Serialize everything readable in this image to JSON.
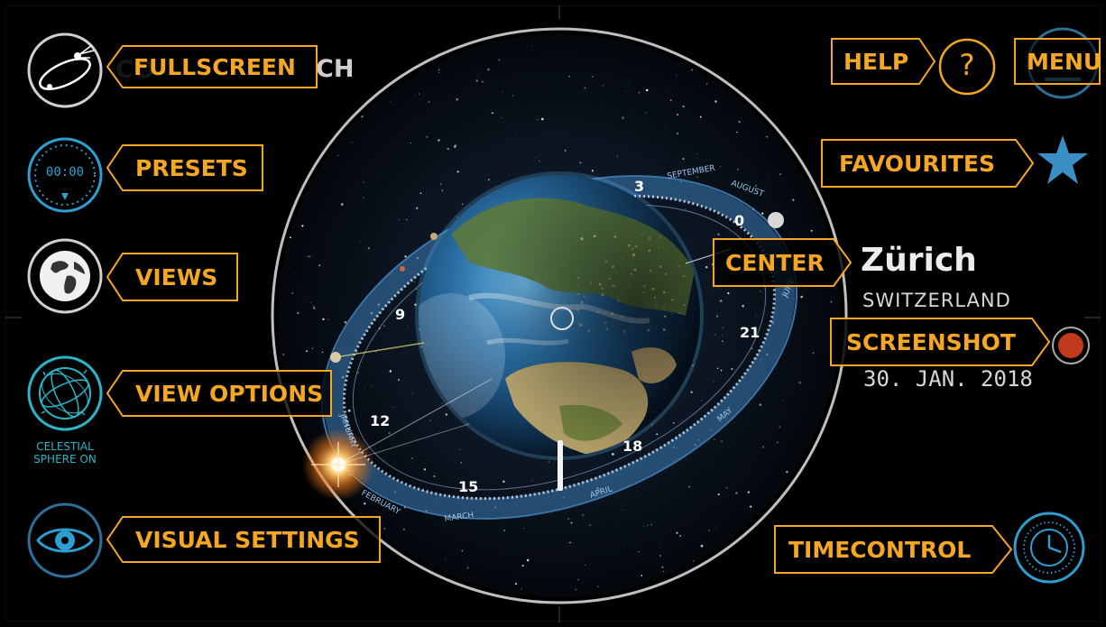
{
  "app": {
    "title_visible": "CH"
  },
  "callouts": {
    "fullscreen": "FULLSCREEN",
    "presets": "PRESETS",
    "views": "VIEWS",
    "view_options": "VIEW OPTIONS",
    "visual_settings": "VISUAL SETTINGS",
    "help": "HELP",
    "menu": "MENU",
    "favourites": "FAVOURITES",
    "center": "CENTER",
    "screenshot": "SCREENSHOT",
    "timecontrol": "TIMECONTROL"
  },
  "presets_icon_time": "00:00",
  "celestial_sphere_status": [
    "CELESTIAL",
    "SPHERE ON"
  ],
  "help_icon_glyph": "?",
  "location": {
    "city": "Zürich",
    "country": "SWITZERLAND",
    "date": "30. JAN. 2018"
  },
  "dial": {
    "hours": [
      "3",
      "0",
      "21",
      "18",
      "15",
      "12",
      "9"
    ],
    "months": [
      "SEPTEMBER",
      "AUGUST",
      "JUNE",
      "MAY",
      "APRIL",
      "MARCH",
      "FEBRUARY",
      "JANUARY"
    ]
  },
  "colors": {
    "accent": "#f5a623",
    "cyan": "#2ab6c9",
    "blue_icon": "#2e9ed0",
    "record": "#c0391b"
  },
  "icons": {
    "fullscreen": "orbit-comet-icon",
    "presets": "stopwatch-icon",
    "views": "earth-globe-icon",
    "view_options": "celestial-sphere-icon",
    "visual_settings": "eye-icon",
    "help": "question-icon",
    "menu": "menu-icon",
    "favourites": "star-icon",
    "screenshot": "record-dot-icon",
    "timecontrol": "clock-icon"
  }
}
